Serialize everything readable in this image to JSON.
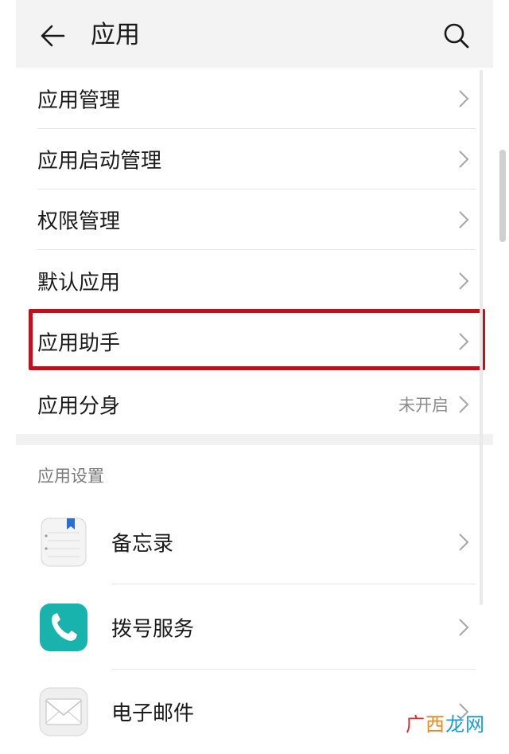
{
  "header": {
    "title": "应用",
    "back_icon": "arrow-left-icon",
    "search_icon": "search-icon"
  },
  "menu": {
    "items": [
      {
        "label": "应用管理"
      },
      {
        "label": "应用启动管理"
      },
      {
        "label": "权限管理"
      },
      {
        "label": "默认应用"
      },
      {
        "label": "应用助手",
        "highlighted": true
      },
      {
        "label": "应用分身",
        "value": "未开启"
      }
    ]
  },
  "settings": {
    "header": "应用设置",
    "apps": [
      {
        "label": "备忘录",
        "icon": "notepad-icon"
      },
      {
        "label": "拨号服务",
        "icon": "phone-icon"
      },
      {
        "label": "电子邮件",
        "icon": "mail-icon"
      }
    ]
  },
  "watermark": {
    "part1": "广",
    "part2": "西",
    "part3": "龙网"
  },
  "colors": {
    "highlight": "#c0101e",
    "phone_icon_bg": "#19b3ad",
    "bookmark": "#2a6fd6",
    "header_bg": "#f3f3f3"
  }
}
